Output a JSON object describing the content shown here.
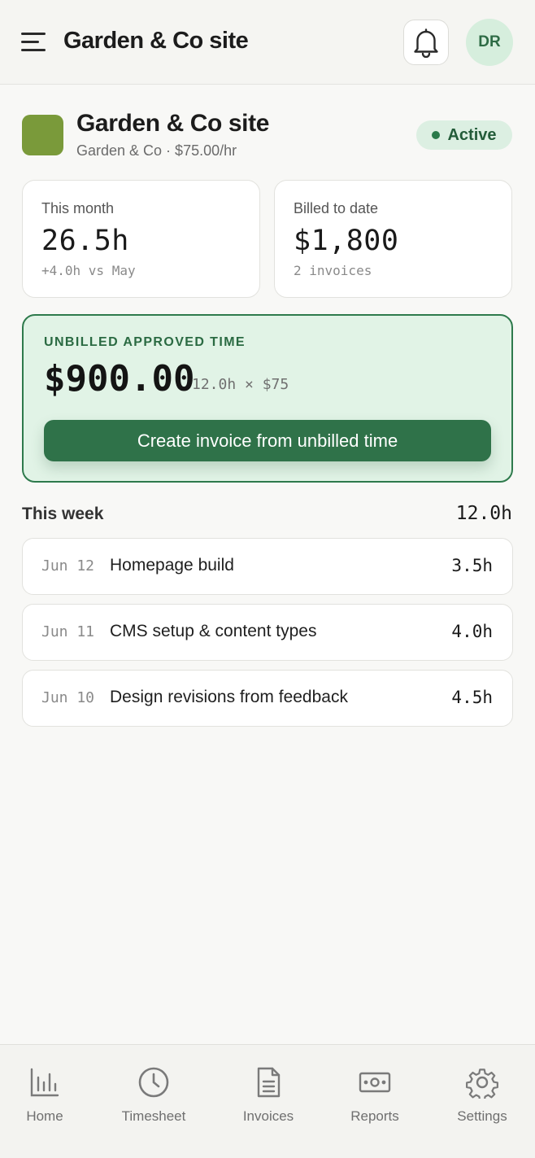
{
  "header": {
    "title": "Garden & Co site",
    "menu_icon": "menu-icon",
    "bell_icon": "bell-icon",
    "avatar_initials": "DR"
  },
  "project": {
    "title": "Garden & Co site",
    "subtitle": "Garden & Co · $75.00/hr",
    "swatch_color": "#7a9a3a",
    "status": "Active",
    "status_color": "#2a7a4a"
  },
  "stats": {
    "this_month": {
      "label": "This month",
      "value": "26.5h",
      "sub": "+4.0h vs May"
    },
    "billed": {
      "label": "Billed to date",
      "value": "$1,800",
      "sub": "2 invoices"
    }
  },
  "unbilled": {
    "label": "UNBILLED APPROVED TIME",
    "amount": "$900.00",
    "calc": "12.0h × $75",
    "button_label": "Create invoice from unbilled time",
    "accent_color": "#2f7249"
  },
  "week": {
    "heading": "This week",
    "total": "12.0h",
    "entries": [
      {
        "date": "Jun 12",
        "description": "Homepage build",
        "hours": "3.5h"
      },
      {
        "date": "Jun 11",
        "description": "CMS setup & content types",
        "hours": "4.0h"
      },
      {
        "date": "Jun 10",
        "description": "Design revisions from feedback",
        "hours": "4.5h"
      }
    ]
  },
  "nav": {
    "items": [
      {
        "label": "Home",
        "icon": "bar-chart-icon"
      },
      {
        "label": "Timesheet",
        "icon": "clock-icon"
      },
      {
        "label": "Invoices",
        "icon": "document-icon"
      },
      {
        "label": "Reports",
        "icon": "cash-icon"
      },
      {
        "label": "Settings",
        "icon": "gear-icon"
      }
    ]
  }
}
